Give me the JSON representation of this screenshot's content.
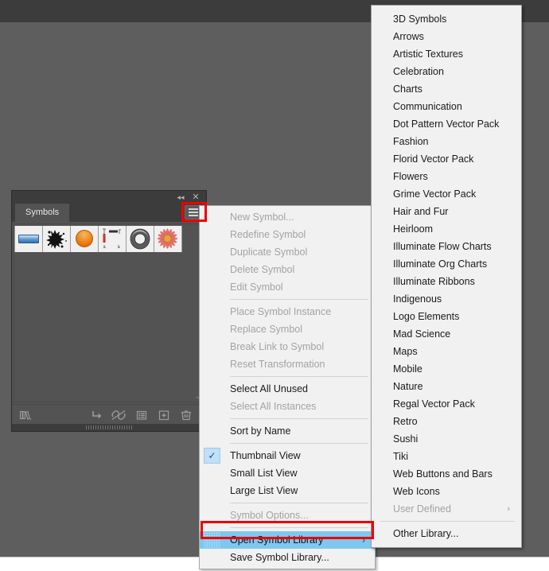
{
  "colors": {
    "canvas": "#5e5e5e",
    "topbar": "#3c3c3c",
    "panel": "#535353",
    "menu_bg": "#f1f1f1",
    "highlight_blue": "#7ec8f0",
    "annotation_red": "#ee0000",
    "check_bg": "#bfe0f6"
  },
  "panel": {
    "tab_label": "Symbols",
    "collapse_icon": "◂◂",
    "close_icon": "✕",
    "menu_icon": "hamburger-icon",
    "scroll_chevron": "⌄",
    "symbols": [
      {
        "name": "blue-gradient-bar-symbol",
        "label": "Blue Gradient Bar"
      },
      {
        "name": "ink-splat-symbol",
        "label": "Ink Splat"
      },
      {
        "name": "orange-sphere-symbol",
        "label": "Orange Sphere"
      },
      {
        "name": "ruler-guides-symbol",
        "label": "Ruler Guides"
      },
      {
        "name": "grey-ring-symbol",
        "label": "Grey Ring"
      },
      {
        "name": "red-daisy-symbol",
        "label": "Red Daisy"
      }
    ],
    "footer_icons": [
      {
        "name": "symbol-libraries-menu-icon",
        "label": "Symbol Libraries Menu"
      },
      {
        "name": "place-symbol-instance-icon",
        "label": "Place Symbol Instance"
      },
      {
        "name": "break-link-to-symbol-icon",
        "label": "Break Link to Symbol"
      },
      {
        "name": "symbol-options-icon",
        "label": "Symbol Options"
      },
      {
        "name": "new-symbol-icon",
        "label": "New Symbol"
      },
      {
        "name": "delete-symbol-icon",
        "label": "Delete Symbol"
      }
    ]
  },
  "flyout_menu": {
    "items": [
      {
        "label": "New Symbol...",
        "disabled": true,
        "type": "item"
      },
      {
        "label": "Redefine Symbol",
        "disabled": true,
        "type": "item"
      },
      {
        "label": "Duplicate Symbol",
        "disabled": true,
        "type": "item"
      },
      {
        "label": "Delete Symbol",
        "disabled": true,
        "type": "item"
      },
      {
        "label": "Edit Symbol",
        "disabled": true,
        "type": "item"
      },
      {
        "type": "separator"
      },
      {
        "label": "Place Symbol Instance",
        "disabled": true,
        "type": "item"
      },
      {
        "label": "Replace Symbol",
        "disabled": true,
        "type": "item"
      },
      {
        "label": "Break Link to Symbol",
        "disabled": true,
        "type": "item"
      },
      {
        "label": "Reset Transformation",
        "disabled": true,
        "type": "item"
      },
      {
        "type": "separator"
      },
      {
        "label": "Select All Unused",
        "disabled": false,
        "type": "item"
      },
      {
        "label": "Select All Instances",
        "disabled": true,
        "type": "item"
      },
      {
        "type": "separator"
      },
      {
        "label": "Sort by Name",
        "disabled": false,
        "type": "item"
      },
      {
        "type": "separator"
      },
      {
        "label": "Thumbnail View",
        "disabled": false,
        "type": "item",
        "checked": true
      },
      {
        "label": "Small List View",
        "disabled": false,
        "type": "item"
      },
      {
        "label": "Large List View",
        "disabled": false,
        "type": "item"
      },
      {
        "type": "separator"
      },
      {
        "label": "Symbol Options...",
        "disabled": true,
        "type": "item"
      },
      {
        "type": "separator"
      },
      {
        "label": "Open Symbol Library",
        "disabled": false,
        "type": "item",
        "selected": true,
        "submenu": true,
        "submark": "›"
      },
      {
        "label": "Save Symbol Library...",
        "disabled": false,
        "type": "item"
      }
    ],
    "checkmark": "✓"
  },
  "library_submenu": {
    "items": [
      {
        "label": "3D Symbols",
        "disabled": false
      },
      {
        "label": "Arrows",
        "disabled": false
      },
      {
        "label": "Artistic Textures",
        "disabled": false
      },
      {
        "label": "Celebration",
        "disabled": false
      },
      {
        "label": "Charts",
        "disabled": false
      },
      {
        "label": "Communication",
        "disabled": false
      },
      {
        "label": "Dot Pattern Vector Pack",
        "disabled": false
      },
      {
        "label": "Fashion",
        "disabled": false
      },
      {
        "label": "Florid Vector Pack",
        "disabled": false
      },
      {
        "label": "Flowers",
        "disabled": false
      },
      {
        "label": "Grime Vector Pack",
        "disabled": false
      },
      {
        "label": "Hair and Fur",
        "disabled": false
      },
      {
        "label": "Heirloom",
        "disabled": false
      },
      {
        "label": "Illuminate Flow Charts",
        "disabled": false
      },
      {
        "label": "Illuminate Org Charts",
        "disabled": false
      },
      {
        "label": "Illuminate Ribbons",
        "disabled": false
      },
      {
        "label": "Indigenous",
        "disabled": false
      },
      {
        "label": "Logo Elements",
        "disabled": false
      },
      {
        "label": "Mad Science",
        "disabled": false
      },
      {
        "label": "Maps",
        "disabled": false
      },
      {
        "label": "Mobile",
        "disabled": false
      },
      {
        "label": "Nature",
        "disabled": false
      },
      {
        "label": "Regal Vector Pack",
        "disabled": false
      },
      {
        "label": "Retro",
        "disabled": false
      },
      {
        "label": "Sushi",
        "disabled": false
      },
      {
        "label": "Tiki",
        "disabled": false
      },
      {
        "label": "Web Buttons and Bars",
        "disabled": false
      },
      {
        "label": "Web Icons",
        "disabled": false
      },
      {
        "label": "User Defined",
        "disabled": true,
        "submenu": true,
        "submark": "›"
      },
      {
        "type": "separator"
      },
      {
        "label": "Other Library...",
        "disabled": false
      }
    ]
  }
}
